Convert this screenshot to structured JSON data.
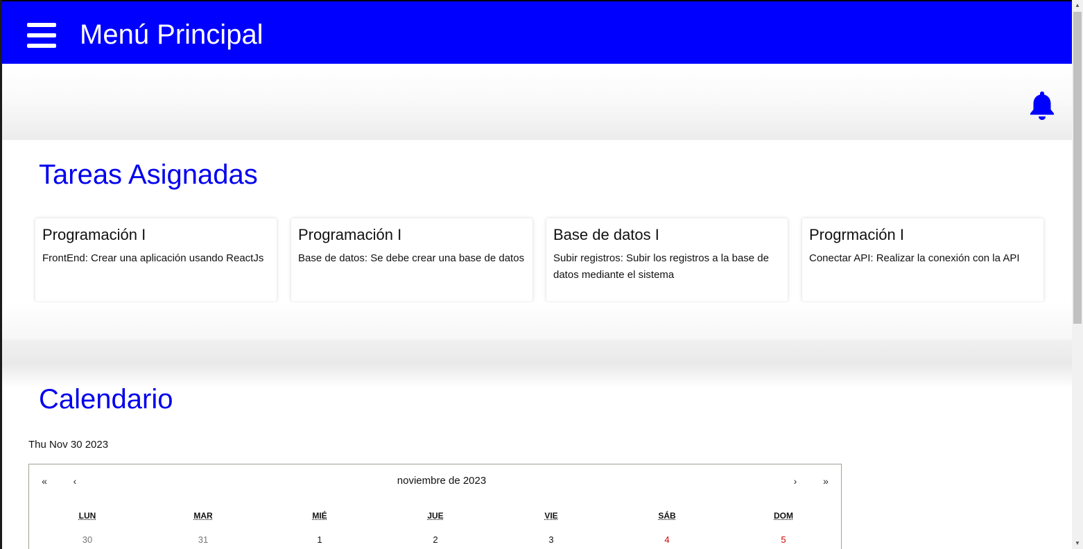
{
  "header": {
    "title": "Menú Principal",
    "menu_icon": "hamburger-menu-icon",
    "background_color": "#0000ff"
  },
  "notifications": {
    "icon": "bell-icon",
    "color": "#0000ff"
  },
  "tasks": {
    "title": "Tareas Asignadas",
    "cards": [
      {
        "title": "Programación I",
        "description": "FrontEnd: Crear una aplicación usando ReactJs"
      },
      {
        "title": "Programación I",
        "description": "Base de datos: Se debe crear una base de datos"
      },
      {
        "title": "Base de datos I",
        "description": "Subir registros: Subir los registros a la base de datos mediante el sistema"
      },
      {
        "title": "Progrmación I",
        "description": "Conectar API: Realizar la conexión con la API"
      }
    ]
  },
  "calendar": {
    "title": "Calendario",
    "selected_date": "Thu Nov 30 2023",
    "nav": {
      "prev2": "«",
      "prev": "‹",
      "label": "noviembre de 2023",
      "next": "›",
      "next2": "»"
    },
    "weekdays": [
      "LUN",
      "MAR",
      "MIÉ",
      "JUE",
      "VIE",
      "SÁB",
      "DOM"
    ],
    "first_row": [
      {
        "day": "30",
        "kind": "neighbor"
      },
      {
        "day": "31",
        "kind": "neighbor"
      },
      {
        "day": "1",
        "kind": "normal"
      },
      {
        "day": "2",
        "kind": "normal"
      },
      {
        "day": "3",
        "kind": "normal"
      },
      {
        "day": "4",
        "kind": "weekend"
      },
      {
        "day": "5",
        "kind": "weekend"
      }
    ],
    "weekend_color": "#d10000",
    "neighbor_color": "#757575"
  }
}
